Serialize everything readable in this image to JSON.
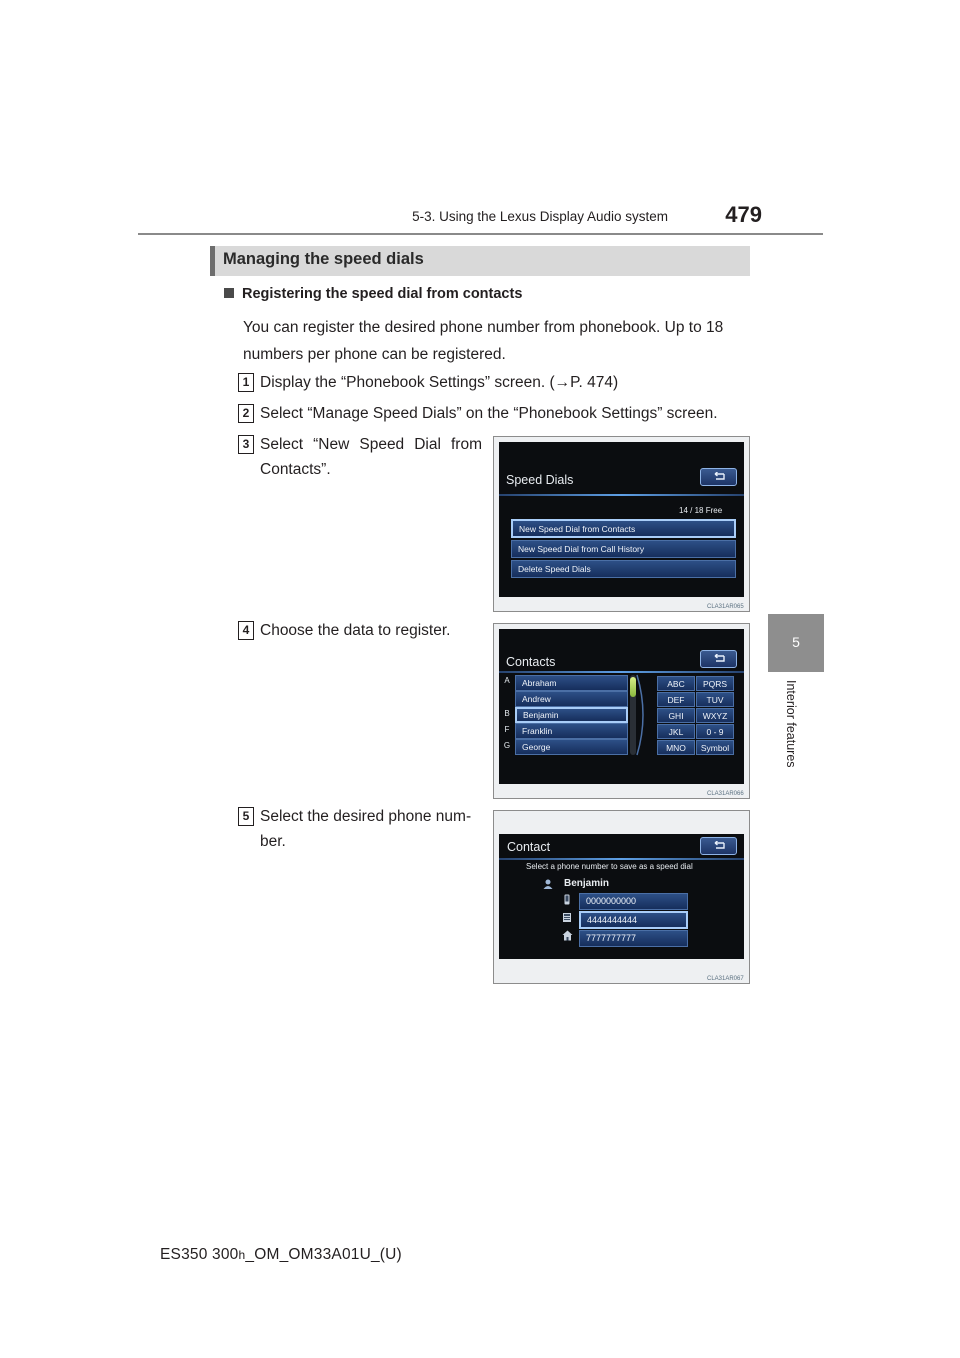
{
  "header": {
    "section": "5-3. Using the Lexus Display Audio system",
    "page_number": "479"
  },
  "side_tab": {
    "chapter_number": "5",
    "chapter_title": "Interior features"
  },
  "section": {
    "title": "Managing the speed dials"
  },
  "subsection": {
    "title": "Registering the speed dial from contacts",
    "intro": "You can register the desired phone number from phonebook. Up to 18 numbers per phone can be registered."
  },
  "steps": [
    {
      "num": "1",
      "text": "Display the “Phonebook Settings” screen. (→P. 474)"
    },
    {
      "num": "2",
      "text": "Select “Manage Speed Dials” on the “Phonebook Settings” screen."
    },
    {
      "num": "3",
      "text": "Select “New Speed Dial from Contacts”."
    },
    {
      "num": "4",
      "text": "Choose the data to register."
    },
    {
      "num": "5",
      "text": "Select the desired phone num-ber."
    }
  ],
  "screen1": {
    "title": "Speed Dials",
    "counter": "14 / 18 Free",
    "buttons": [
      "New Speed Dial from Contacts",
      "New Speed Dial from Call History",
      "Delete Speed Dials"
    ],
    "figure_code": "CLA31AR065"
  },
  "screen2": {
    "title": "Contacts",
    "letters": [
      "A",
      "B",
      "F",
      "G"
    ],
    "names": [
      "Abraham",
      "Andrew",
      "Benjamin",
      "Franklin",
      "George"
    ],
    "keys": [
      "ABC",
      "PQRS",
      "DEF",
      "TUV",
      "GHI",
      "WXYZ",
      "JKL",
      "0 - 9",
      "MNO",
      "Symbol"
    ],
    "figure_code": "CLA31AR066"
  },
  "screen3": {
    "title": "Contact",
    "instruction": "Select a phone number to save as a speed dial",
    "contact_name": "Benjamin",
    "numbers": [
      "0000000000",
      "4444444444",
      "7777777777"
    ],
    "figure_code": "CLA31AR067"
  },
  "footer": {
    "doc_prefix": "ES350 300",
    "doc_h": "h",
    "doc_suffix": "_OM_OM33A01U_(U)"
  }
}
